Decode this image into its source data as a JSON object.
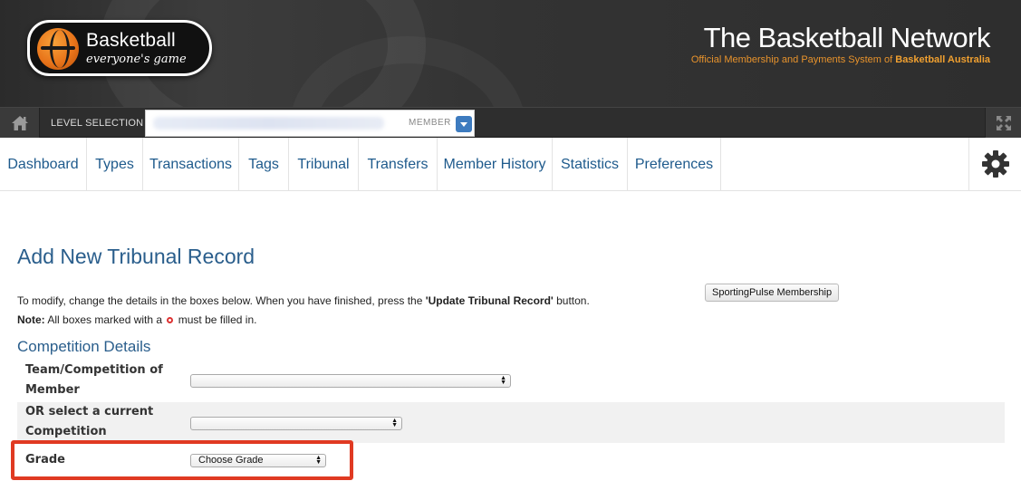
{
  "header": {
    "logo_main": "Basketball",
    "logo_tagline": "everyone's game",
    "network_title": "The Basketball Network",
    "network_sub_a": "Official Membership and Payments System of ",
    "network_sub_b": "Basketball Australia"
  },
  "levelbar": {
    "home_icon": "home-icon",
    "label": "LEVEL SELECTION",
    "member_tag": "MEMBER",
    "expand_icon": "expand-icon"
  },
  "nav": {
    "items": [
      {
        "label": "Dashboard"
      },
      {
        "label": "Types"
      },
      {
        "label": "Transactions"
      },
      {
        "label": "Tags"
      },
      {
        "label": "Tribunal"
      },
      {
        "label": "Transfers"
      },
      {
        "label": "Member History"
      },
      {
        "label": "Statistics"
      },
      {
        "label": "Preferences"
      }
    ],
    "settings_icon": "gear-icon"
  },
  "main": {
    "title": "Add New Tribunal Record",
    "intro_a": "To modify, change the details in the boxes below. When you have finished, press the ",
    "intro_button_ref": "'Update Tribunal Record'",
    "intro_b": " button.",
    "note_label": "Note:",
    "note_a": " All boxes marked with a ",
    "note_b": " must be filled in.",
    "sp_button": "SportingPulse Membership",
    "section": "Competition Details",
    "fields": [
      {
        "label_1": "Team/Competition of",
        "label_2": "Member",
        "value": ""
      },
      {
        "label_1": "OR select a current",
        "label_2": "Competition",
        "value": ""
      },
      {
        "label_1": "Grade",
        "value": "Choose Grade"
      }
    ]
  },
  "colors": {
    "header_bg": "#333333",
    "link": "#1e5a8c",
    "title": "#2a5e8c",
    "accent_orange": "#e8932c",
    "highlight_red": "#e03a22"
  }
}
